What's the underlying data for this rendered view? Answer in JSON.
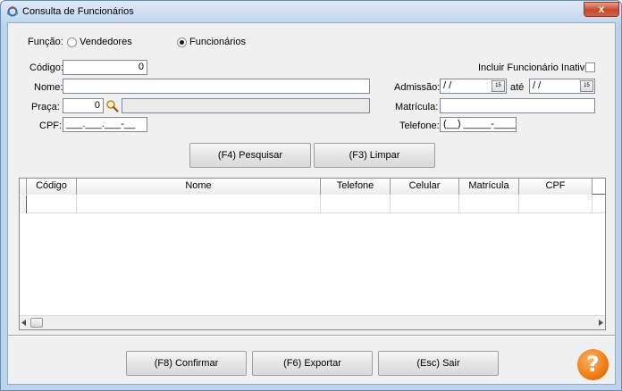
{
  "window": {
    "title": "Consulta de Funcionários",
    "close_label": "x"
  },
  "funcao": {
    "label": "Função:",
    "options": [
      {
        "label": "Vendedores",
        "selected": false
      },
      {
        "label": "Funcionários",
        "selected": true
      }
    ]
  },
  "form": {
    "codigo": {
      "label": "Código:",
      "value": "0"
    },
    "nome": {
      "label": "Nome:",
      "value": ""
    },
    "praca": {
      "label": "Praça:",
      "value": "0",
      "description": ""
    },
    "cpf": {
      "label": "CPF:",
      "value": "___.___.___-__"
    },
    "incluir_inativo": {
      "label": "Incluir Funcionário Inativo:",
      "checked": false
    },
    "admissao": {
      "label": "Admissão:",
      "from": " /  /",
      "to_label": "até",
      "to": " /  /",
      "calendar_label": "15"
    },
    "matricula": {
      "label": "Matrícula:",
      "value": ""
    },
    "telefone": {
      "label": "Telefone:",
      "value": "(__) _____-____"
    }
  },
  "search_buttons": {
    "pesquisar": "(F4) Pesquisar",
    "limpar": "(F3) Limpar"
  },
  "grid": {
    "columns": [
      "Código",
      "Nome",
      "Telefone",
      "Celular",
      "Matrícula",
      "CPF"
    ],
    "rows": []
  },
  "footer_buttons": {
    "confirmar": "(F8) Confirmar",
    "exportar": "(F6) Exportar",
    "sair": "(Esc) Sair"
  },
  "help": {
    "label": "?"
  },
  "colors": {
    "accent": "#f07b10",
    "title_bar": "#c2d6ec",
    "close": "#c7462c"
  }
}
